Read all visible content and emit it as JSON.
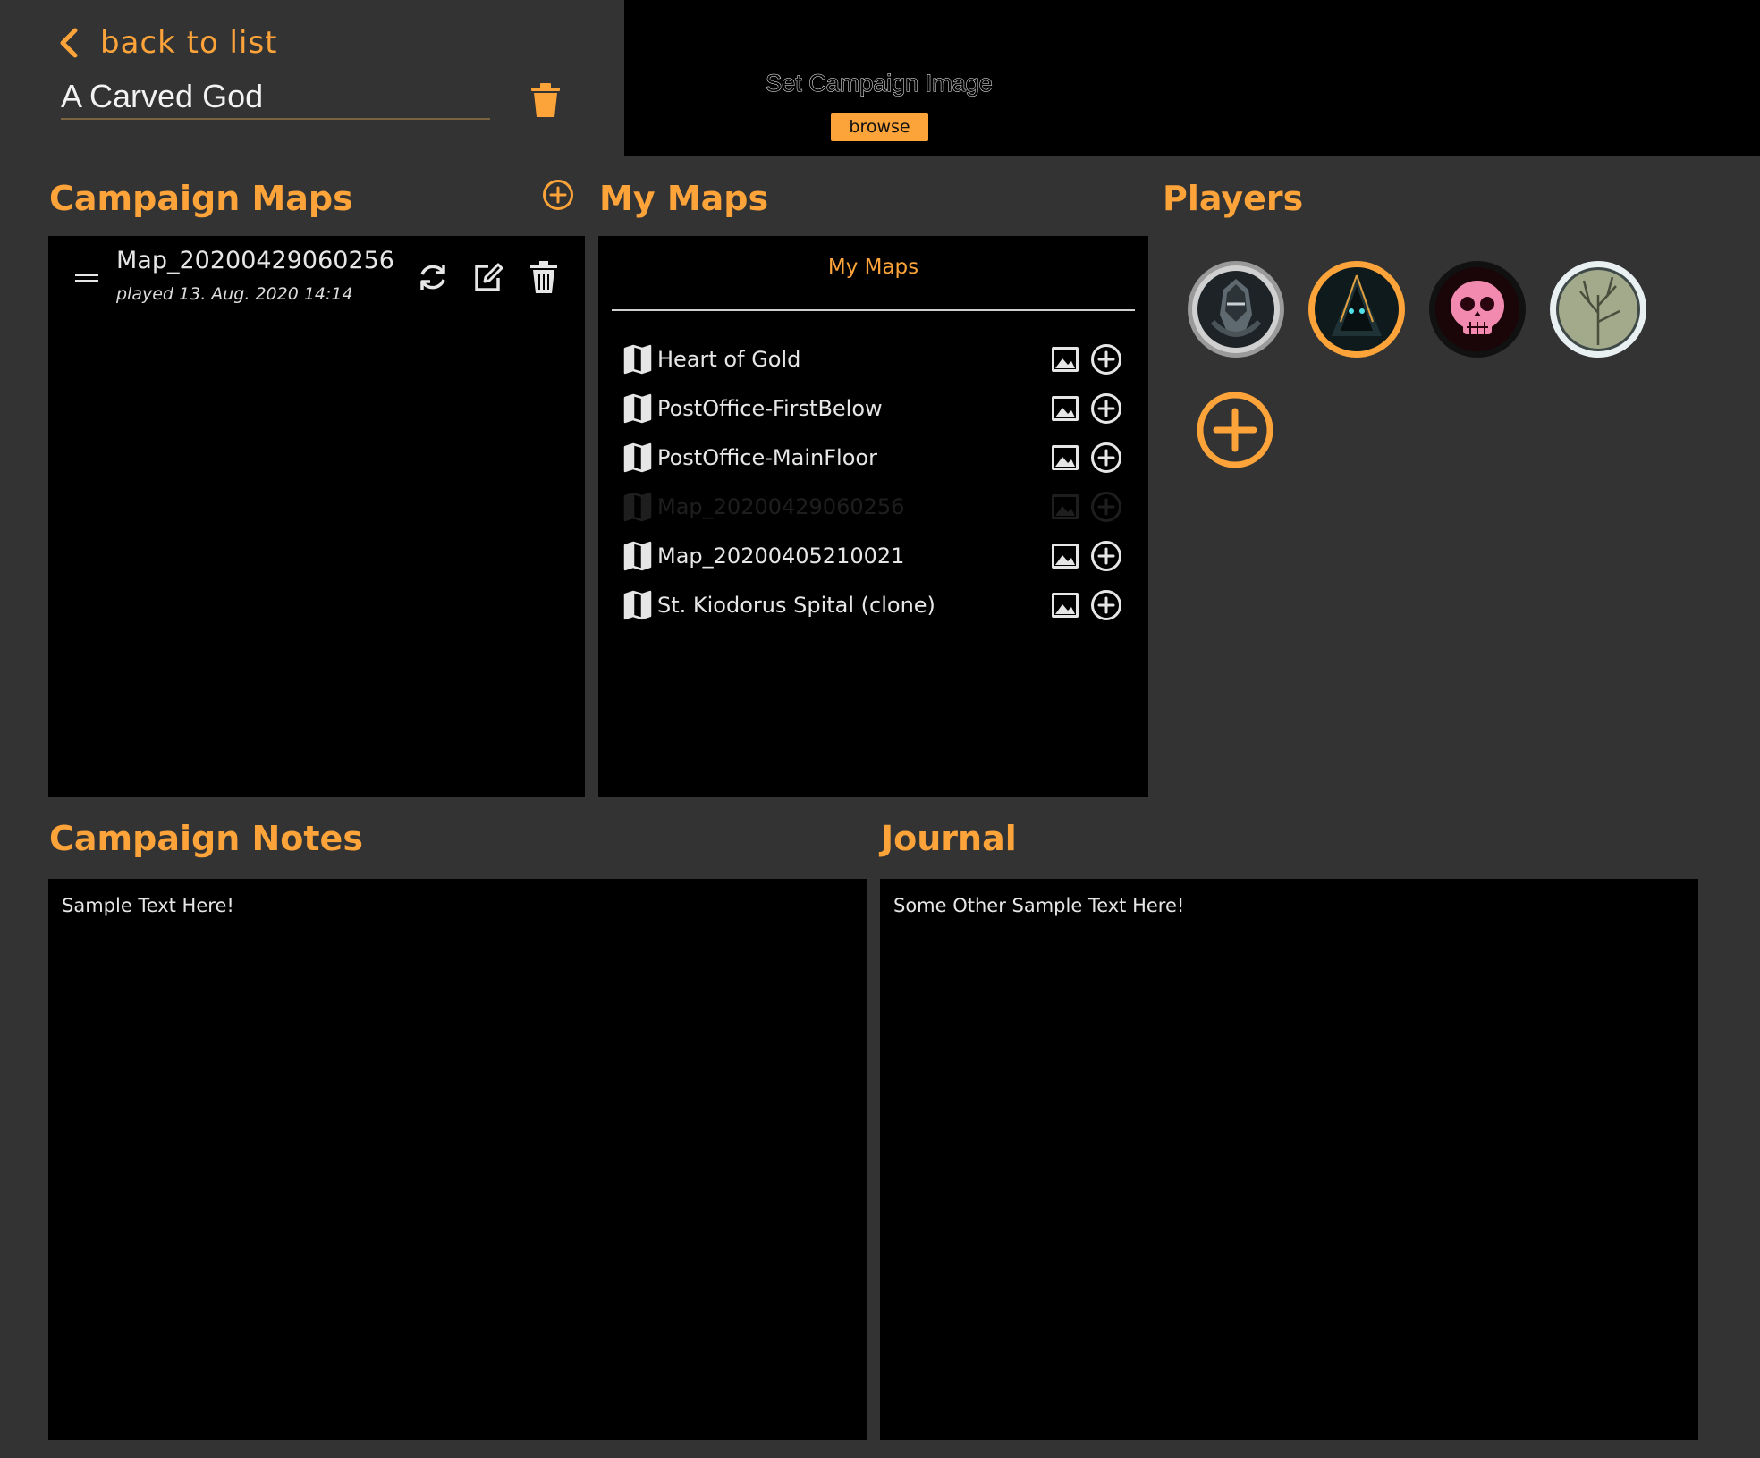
{
  "header": {
    "back_label": "back to list",
    "campaign_title": "A Carved God",
    "set_image_label": "Set Campaign Image",
    "browse_label": "browse"
  },
  "colors": {
    "accent": "#fca33a",
    "background": "#333333",
    "panel": "#000000",
    "text": "#e6e6e6"
  },
  "campaign_maps": {
    "title": "Campaign Maps",
    "items": [
      {
        "name": "Map_20200429060256",
        "played": "played 13. Aug. 2020 14:14"
      }
    ]
  },
  "my_maps": {
    "title": "My Maps",
    "tab_label": "My Maps",
    "items": [
      {
        "label": "Heart of Gold",
        "disabled": false
      },
      {
        "label": "PostOffice-FirstBelow",
        "disabled": false
      },
      {
        "label": "PostOffice-MainFloor",
        "disabled": false
      },
      {
        "label": "Map_20200429060256",
        "disabled": true
      },
      {
        "label": "Map_20200405210021",
        "disabled": false
      },
      {
        "label": "St. Kiodorus Spital (clone)",
        "disabled": false
      }
    ]
  },
  "players": {
    "title": "Players",
    "avatars": [
      {
        "icon": "armored-helm-avatar",
        "ring": "#c9c9c9"
      },
      {
        "icon": "hooded-figure-avatar",
        "ring": "#fca33a"
      },
      {
        "icon": "pink-skull-avatar",
        "ring": "#111111"
      },
      {
        "icon": "tree-sketch-avatar",
        "ring": "#e9f0f2"
      }
    ]
  },
  "notes": {
    "title": "Campaign Notes",
    "content": "Sample Text Here!"
  },
  "journal": {
    "title": "Journal",
    "content": "Some Other Sample Text Here!"
  }
}
